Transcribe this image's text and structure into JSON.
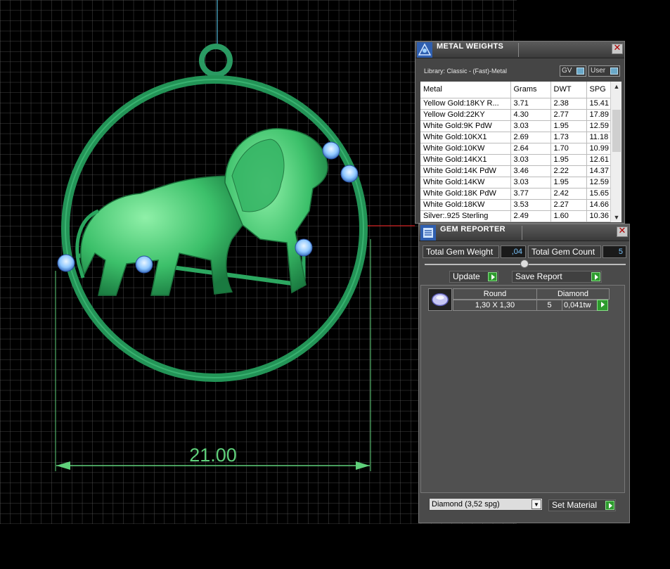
{
  "viewport": {
    "dimension_label": "21.00",
    "colors": {
      "background": "#000000",
      "grid": "#5a5a5a",
      "model": "#2fa86a",
      "dimension": "#5fcf7a",
      "gem": "#8fd0ff"
    }
  },
  "metal_weights": {
    "title": "METAL WEIGHTS",
    "close_icon": "close-icon",
    "library_label": "Library: Classic - (Fast)-Metal",
    "gv_label": "GV",
    "user_label": "User",
    "columns": [
      "Metal",
      "Grams",
      "DWT",
      "SPG"
    ],
    "rows": [
      [
        "Yellow Gold:18KY R...",
        "3.71",
        "2.38",
        "15.41"
      ],
      [
        "Yellow Gold:22KY",
        "4.30",
        "2.77",
        "17.89"
      ],
      [
        "White Gold:9K PdW",
        "3.03",
        "1.95",
        "12.59"
      ],
      [
        "White Gold:10KX1",
        "2.69",
        "1.73",
        "11.18"
      ],
      [
        "White Gold:10KW",
        "2.64",
        "1.70",
        "10.99"
      ],
      [
        "White Gold:14KX1",
        "3.03",
        "1.95",
        "12.61"
      ],
      [
        "White Gold:14K PdW",
        "3.46",
        "2.22",
        "14.37"
      ],
      [
        "White Gold:14KW",
        "3.03",
        "1.95",
        "12.59"
      ],
      [
        "White Gold:18K PdW",
        "3.77",
        "2.42",
        "15.65"
      ],
      [
        "White Gold:18KW",
        "3.53",
        "2.27",
        "14.66"
      ],
      [
        "Silver:.925 Sterling",
        "2.49",
        "1.60",
        "10.36"
      ]
    ]
  },
  "gem_reporter": {
    "title": "GEM REPORTER",
    "total_weight_label": "Total Gem Weight",
    "total_weight_value": ",04",
    "total_count_label": "Total Gem Count",
    "total_count_value": "5",
    "update_label": "Update",
    "save_report_label": "Save Report",
    "gem_headers": [
      "Round",
      "Diamond"
    ],
    "gem_row": {
      "size": "1,30 X 1,30",
      "count": "5",
      "weight": "0,041tw"
    },
    "material_select": "Diamond     (3,52 spg)",
    "set_material_label": "Set Material"
  }
}
